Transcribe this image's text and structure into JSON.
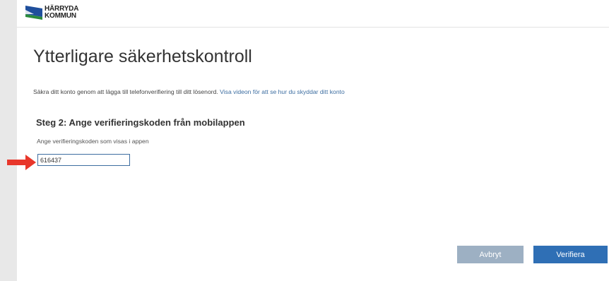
{
  "header": {
    "logo": {
      "line1": "HÄRRYDA",
      "line2": "KOMMUN",
      "icon": "harryda-kommun-logo"
    }
  },
  "main": {
    "title": "Ytterligare säkerhetskontroll",
    "intro_text": "Säkra ditt konto genom att lägga till telefonverifiering till ditt lösenord. ",
    "intro_link": "Visa videon för att se hur du skyddar ditt konto",
    "step_title": "Steg 2: Ange verifieringskoden från mobilappen",
    "code_label": "Ange verifieringskoden som visas i appen",
    "code_value": "616437"
  },
  "buttons": {
    "cancel_label": "Avbryt",
    "verify_label": "Verifiera"
  },
  "colors": {
    "accent": "#2f6fb5",
    "cancel_disabled": "#9db0c3",
    "link": "#3d6ea1",
    "annotation_arrow": "#e8372b"
  }
}
